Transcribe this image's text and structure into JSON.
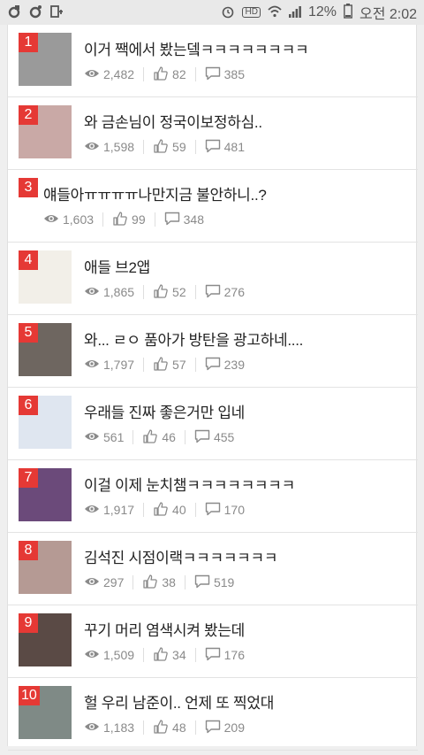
{
  "statusbar": {
    "left_icons": [
      "notification-icon",
      "camera-icon",
      "download-icon"
    ],
    "right_icons": [
      "alarm-icon",
      "hd-icon",
      "wifi-icon",
      "signal-icon",
      "battery-icon"
    ],
    "hd_label": "HD",
    "battery": "12%",
    "time": "오전 2:02"
  },
  "posts": [
    {
      "rank": "1",
      "title": "이거 짹에서 봤는뎈ㅋㅋㅋㅋㅋㅋㅋㅋ",
      "views": "2,482",
      "likes": "82",
      "comments": "385",
      "has_thumb": true,
      "thumb_color": "#9a9a9a"
    },
    {
      "rank": "2",
      "title": "와 금손님이 정국이보정하심..",
      "views": "1,598",
      "likes": "59",
      "comments": "481",
      "has_thumb": true,
      "thumb_color": "#c9a9a6"
    },
    {
      "rank": "3",
      "title": "얘들아ㅠㅠㅠㅠ나만지금 불안하니..?",
      "views": "1,603",
      "likes": "99",
      "comments": "348",
      "has_thumb": false,
      "thumb_color": "#ffffff"
    },
    {
      "rank": "4",
      "title": "애들 브2앱",
      "views": "1,865",
      "likes": "52",
      "comments": "276",
      "has_thumb": true,
      "thumb_color": "#f2efe8"
    },
    {
      "rank": "5",
      "title": "와... ㄹㅇ 품아가 방탄을 광고하네....",
      "views": "1,797",
      "likes": "57",
      "comments": "239",
      "has_thumb": true,
      "thumb_color": "#6e6660"
    },
    {
      "rank": "6",
      "title": "우래들 진짜 좋은거만 입네",
      "views": "561",
      "likes": "46",
      "comments": "455",
      "has_thumb": true,
      "thumb_color": "#dfe6f0"
    },
    {
      "rank": "7",
      "title": "이걸 이제 눈치챔ㅋㅋㅋㅋㅋㅋㅋㅋ",
      "views": "1,917",
      "likes": "40",
      "comments": "170",
      "has_thumb": true,
      "thumb_color": "#6b4a7a"
    },
    {
      "rank": "8",
      "title": "김석진 시점이랙ㅋㅋㅋㅋㅋㅋㅋ",
      "views": "297",
      "likes": "38",
      "comments": "519",
      "has_thumb": true,
      "thumb_color": "#b59a94"
    },
    {
      "rank": "9",
      "title": "꾸기 머리 염색시켜 봤는데",
      "views": "1,509",
      "likes": "34",
      "comments": "176",
      "has_thumb": true,
      "thumb_color": "#5a4a45"
    },
    {
      "rank": "10",
      "title": "헐 우리 남준이.. 언제 또 찍었대",
      "views": "1,183",
      "likes": "48",
      "comments": "209",
      "has_thumb": true,
      "thumb_color": "#7f8a86"
    }
  ],
  "icons": {
    "views": "eye-icon",
    "likes": "thumbs-up-icon",
    "comments": "comment-icon"
  },
  "colors": {
    "rank_badge": "#e53935",
    "text": "#222222",
    "meta": "#8a8a8a"
  }
}
